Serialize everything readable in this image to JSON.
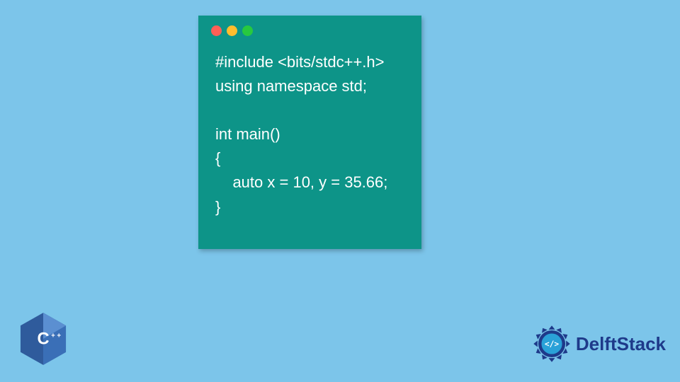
{
  "code": {
    "lines": "#include <bits/stdc++.h>\nusing namespace std;\n\nint main()\n{\n    auto x = 10, y = 35.66;\n}"
  },
  "cpp_badge": {
    "label": "C++"
  },
  "delft": {
    "brand": "DelftStack",
    "icon_glyph": "</>"
  },
  "colors": {
    "bg": "#7cc5ea",
    "window": "#0d9488",
    "brand_text": "#1e3a8a",
    "cpp_blue": "#2f5b9c"
  }
}
